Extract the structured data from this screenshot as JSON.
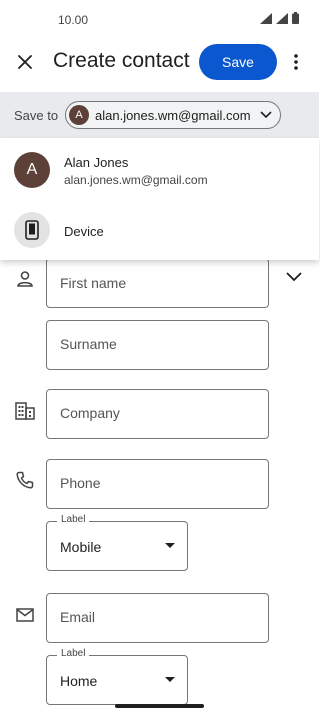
{
  "status_bar": {
    "time": "10.00"
  },
  "app_bar": {
    "title": "Create contact",
    "save_label": "Save"
  },
  "save_to": {
    "label": "Save to",
    "account_initial": "A",
    "account_email": "alan.jones.wm@gmail.com"
  },
  "menu": {
    "items": [
      {
        "name": "Alan Jones",
        "email": "alan.jones.wm@gmail.com",
        "initial": "A"
      },
      {
        "name": "Device"
      }
    ]
  },
  "form": {
    "first_name_placeholder": "First name",
    "surname_placeholder": "Surname",
    "company_placeholder": "Company",
    "phone_placeholder": "Phone",
    "phone_label_legend": "Label",
    "phone_label_value": "Mobile",
    "email_placeholder": "Email",
    "email_label_legend": "Label",
    "email_label_value": "Home"
  },
  "colors": {
    "accent": "#0b57d0",
    "avatar": "#5d4037",
    "bar": "#e8eaed"
  }
}
